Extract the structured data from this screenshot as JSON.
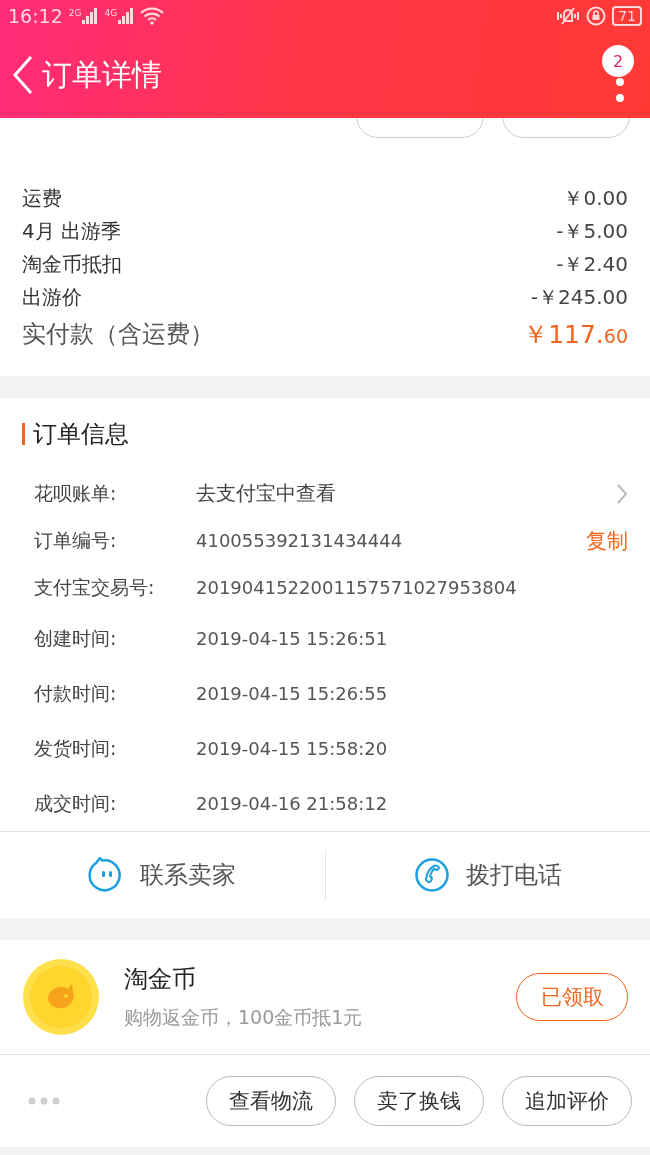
{
  "status_bar": {
    "time": "16:12",
    "networks": [
      "2G",
      "4G"
    ],
    "battery": "71"
  },
  "header": {
    "title": "订单详情",
    "badge": "2"
  },
  "partial_buttons": [
    {
      "kind": "outlined"
    },
    {
      "kind": "outlined"
    }
  ],
  "fees": [
    {
      "label": "运费",
      "value": "￥0.00"
    },
    {
      "label": "4月 出游季",
      "value": "-￥5.00"
    },
    {
      "label": "淘金币抵扣",
      "value": "-￥2.40"
    },
    {
      "label": "出游价",
      "value": "-￥245.00"
    }
  ],
  "total": {
    "label": "实付款（含运费）",
    "amount": "￥117.",
    "decimals": "60"
  },
  "order_info": {
    "title": "订单信息",
    "rows": [
      {
        "kind": "link",
        "label": "花呗账单:",
        "value": "去支付宝中查看"
      },
      {
        "kind": "copy",
        "label": "订单编号:",
        "value": "410055392131434444",
        "action": "复制"
      },
      {
        "kind": "plain",
        "label": "支付宝交易号:",
        "value": "2019041522001157571027953804"
      },
      {
        "kind": "plain",
        "label": "创建时间:",
        "value": "2019-04-15 15:26:51"
      },
      {
        "kind": "plain",
        "label": "付款时间:",
        "value": "2019-04-15 15:26:55"
      },
      {
        "kind": "plain",
        "label": "发货时间:",
        "value": "2019-04-15 15:58:20"
      },
      {
        "kind": "plain",
        "label": "成交时间:",
        "value": "2019-04-16 21:58:12"
      }
    ]
  },
  "contact": [
    {
      "kind": "chat",
      "label": "联系卖家"
    },
    {
      "kind": "phone",
      "label": "拨打电话"
    }
  ],
  "coins": {
    "title": "淘金币",
    "subtitle": "购物返金币，100金币抵1元",
    "button": "已领取"
  },
  "bottom_bar": {
    "buttons": [
      "查看物流",
      "卖了换钱",
      "追加评价"
    ]
  }
}
